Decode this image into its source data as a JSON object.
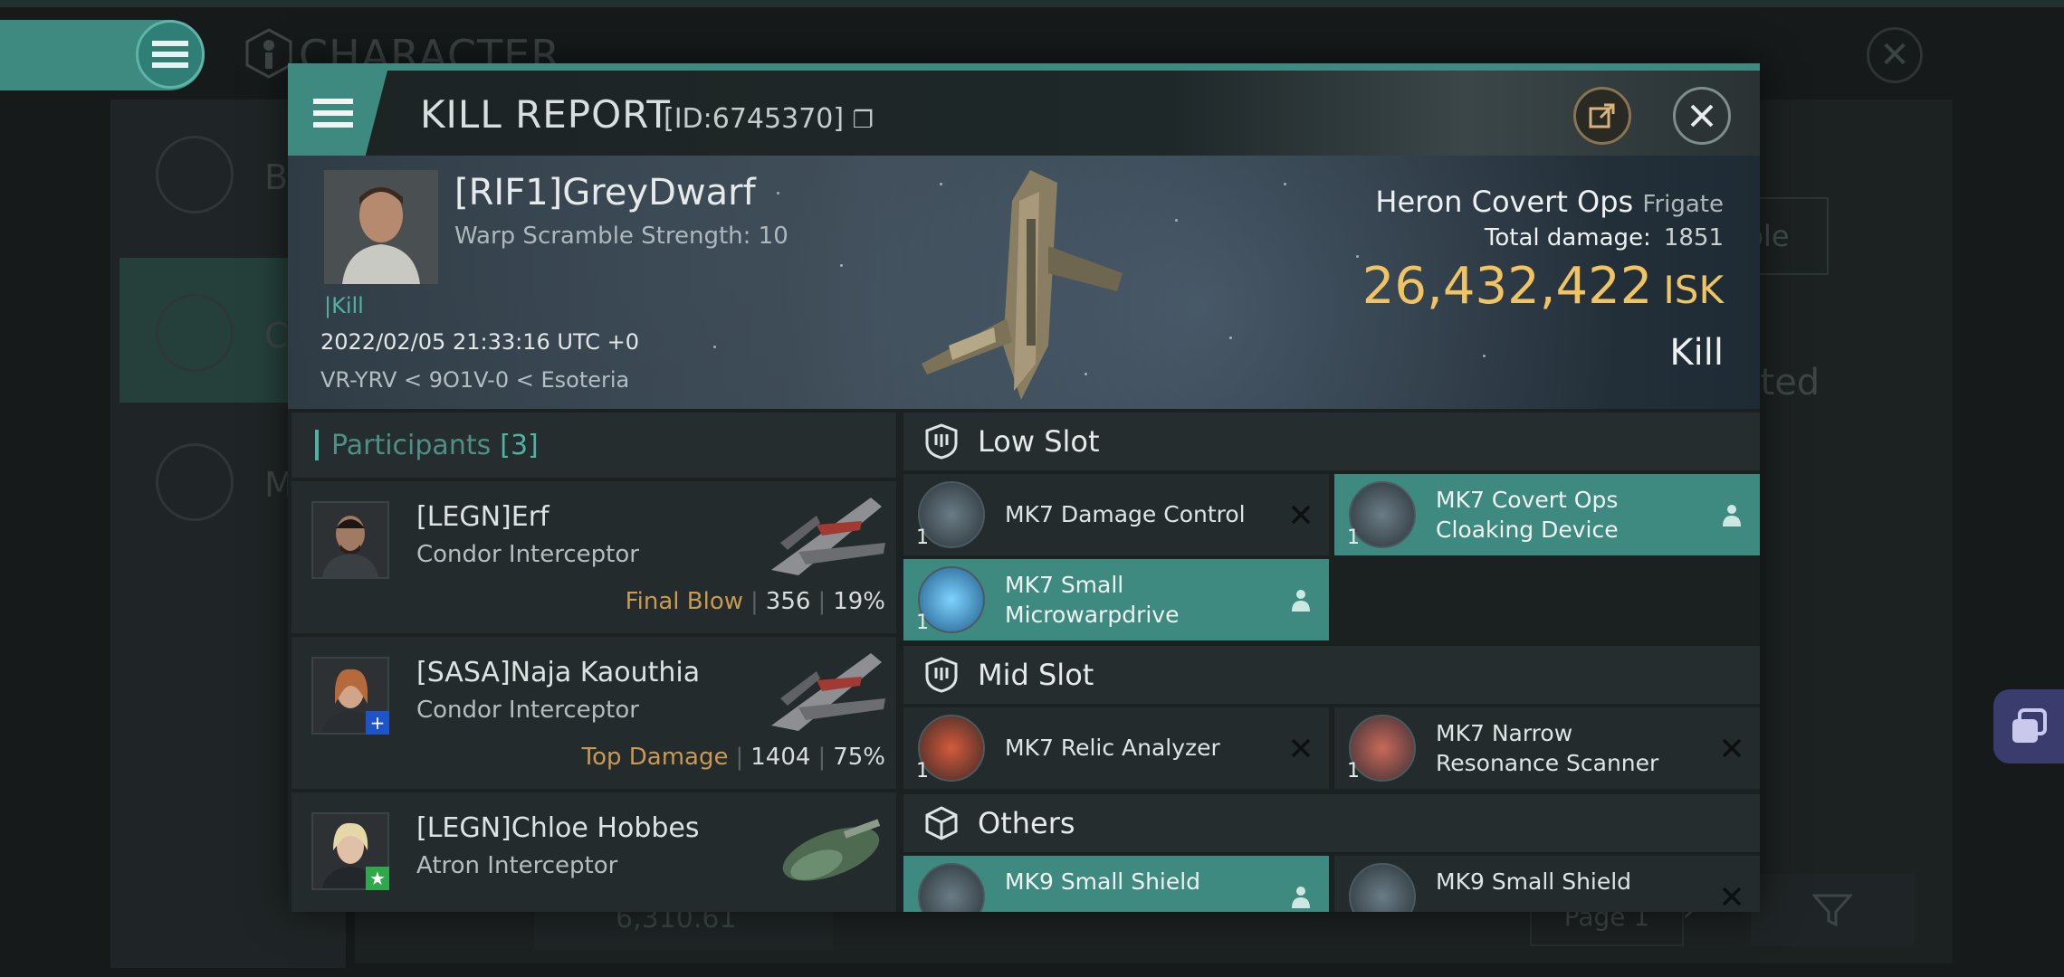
{
  "background": {
    "title": "CHARACTER",
    "sidebar_items": [
      "Bi",
      "Co",
      "Mi"
    ],
    "right_button_text": "able",
    "right_text": "ated",
    "bottom_value": "6,310.61",
    "page_label": "Page 1"
  },
  "modal": {
    "title": "KILL REPORT",
    "report_id": "[ID:6745370]"
  },
  "victim": {
    "name": "[RIF1]GreyDwarf",
    "warp_scramble": "Warp Scramble Strength: 10",
    "kill_tag": "Kill",
    "date": "2022/02/05 21:33:16 UTC +0",
    "location": "VR-YRV < 9O1V-0 < Esoteria",
    "ship_name": "Heron Covert Ops",
    "ship_class": "Frigate",
    "total_damage_label": "Total damage:",
    "total_damage": "1851",
    "isk_value": "26,432,422",
    "isk_unit": "ISK",
    "result": "Kill"
  },
  "participants": {
    "label": "Participants",
    "count": "[3]",
    "rows": [
      {
        "name": "[LEGN]Erf",
        "ship": "Condor Interceptor",
        "tag": "Final Blow",
        "damage": "356",
        "percent": "19%"
      },
      {
        "name": "[SASA]Naja Kaouthia",
        "ship": "Condor Interceptor",
        "tag": "Top Damage",
        "damage": "1404",
        "percent": "75%"
      },
      {
        "name": "[LEGN]Chloe Hobbes",
        "ship": "Atron Interceptor",
        "tag": "",
        "damage": "",
        "percent": ""
      }
    ]
  },
  "slots": {
    "low_slot": "Low Slot",
    "mid_slot": "Mid Slot",
    "others": "Others",
    "low_items": [
      {
        "name1": "MK7 Damage Control",
        "name2": "",
        "qty": "1",
        "state": "destroyed"
      },
      {
        "name1": "MK7 Covert Ops",
        "name2": "Cloaking Device",
        "qty": "1",
        "state": "dropped"
      },
      {
        "name1": "MK7 Small",
        "name2": "Microwarpdrive",
        "qty": "1",
        "state": "dropped"
      }
    ],
    "mid_items": [
      {
        "name1": "MK7 Relic Analyzer",
        "name2": "",
        "qty": "1",
        "state": "destroyed"
      },
      {
        "name1": "MK7 Narrow",
        "name2": "Resonance Scanner",
        "qty": "1",
        "state": "destroyed"
      }
    ],
    "other_items": [
      {
        "name1": "MK9 Small Shield",
        "name2": "",
        "qty": "1",
        "state": "dropped"
      },
      {
        "name1": "MK9 Small Shield",
        "name2": "",
        "qty": "1",
        "state": "destroyed"
      }
    ]
  },
  "colors": {
    "accent": "#3f8a80",
    "isk": "#f0c363",
    "tag": "#c99a4f"
  }
}
